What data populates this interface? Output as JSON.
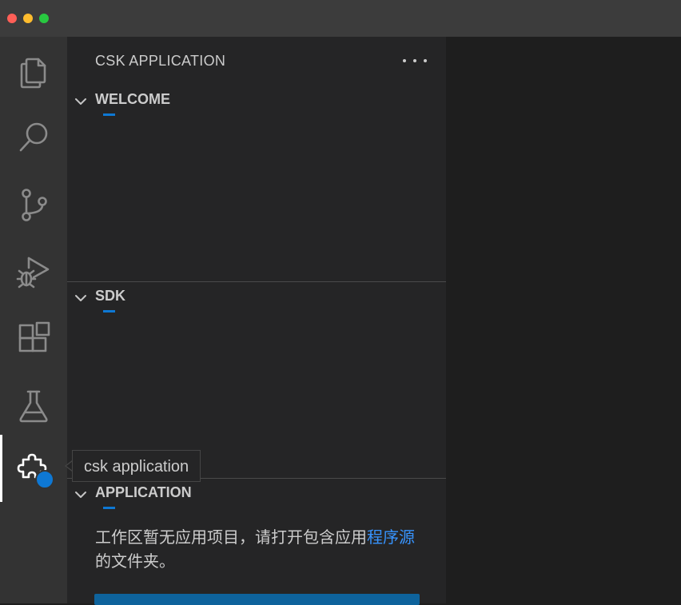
{
  "window": {
    "controls": [
      "close",
      "minimize",
      "zoom"
    ]
  },
  "activity_bar": {
    "items": [
      {
        "name": "explorer",
        "icon": "files-icon",
        "active": false
      },
      {
        "name": "search",
        "icon": "search-icon",
        "active": false
      },
      {
        "name": "source-control",
        "icon": "source-control-icon",
        "active": false
      },
      {
        "name": "run-and-debug",
        "icon": "run-debug-icon",
        "active": false
      },
      {
        "name": "extensions",
        "icon": "extensions-icon",
        "active": false
      },
      {
        "name": "testing",
        "icon": "beaker-icon",
        "active": false
      },
      {
        "name": "csk-application",
        "icon": "puzzle-icon",
        "active": true
      }
    ]
  },
  "sidebar": {
    "title": "CSK APPLICATION",
    "more_icon": "ellipsis-icon",
    "sections": {
      "welcome": {
        "title": "WELCOME",
        "expanded": true
      },
      "sdk": {
        "title": "SDK",
        "expanded": true
      },
      "application": {
        "title": "APPLICATION",
        "expanded": true,
        "message": "工作区暂无应用项目，请打开包含应用",
        "link_text": "程序源",
        "message_suffix": "的文件夹。"
      }
    }
  },
  "tooltip": {
    "text": "csk application"
  },
  "colors": {
    "accent": "#0e78d4",
    "link": "#3794ff",
    "button": "#0e639c"
  }
}
